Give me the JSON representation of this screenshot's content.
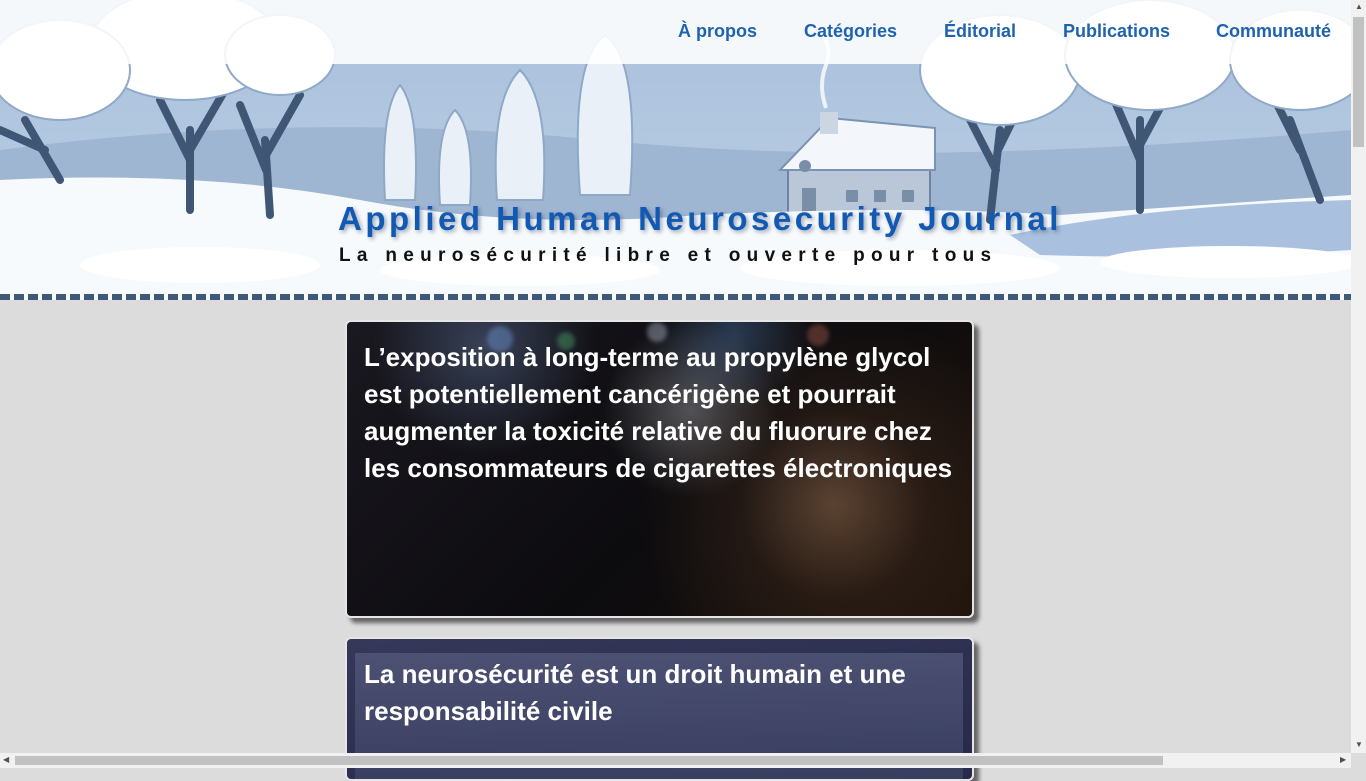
{
  "nav": {
    "items": [
      {
        "label": "À propos"
      },
      {
        "label": "Catégories"
      },
      {
        "label": "Éditorial"
      },
      {
        "label": "Publications"
      },
      {
        "label": "Communauté"
      }
    ]
  },
  "header": {
    "title": "Applied Human Neurosecurity Journal",
    "tagline": "La neurosécurité libre et ouverte pour tous"
  },
  "articles": [
    {
      "title": "L’exposition à long-terme au propylène glycol est potentiellement cancérigène et pourrait augmenter la toxicité relative du fluorure chez les consommateurs de cigarettes électroniques"
    },
    {
      "title": "La neurosécurité est un droit humain et une responsabilité civile"
    }
  ],
  "colors": {
    "nav_link": "#1f63b0",
    "site_title": "#1259b4",
    "page_background": "#dcdcdc"
  }
}
